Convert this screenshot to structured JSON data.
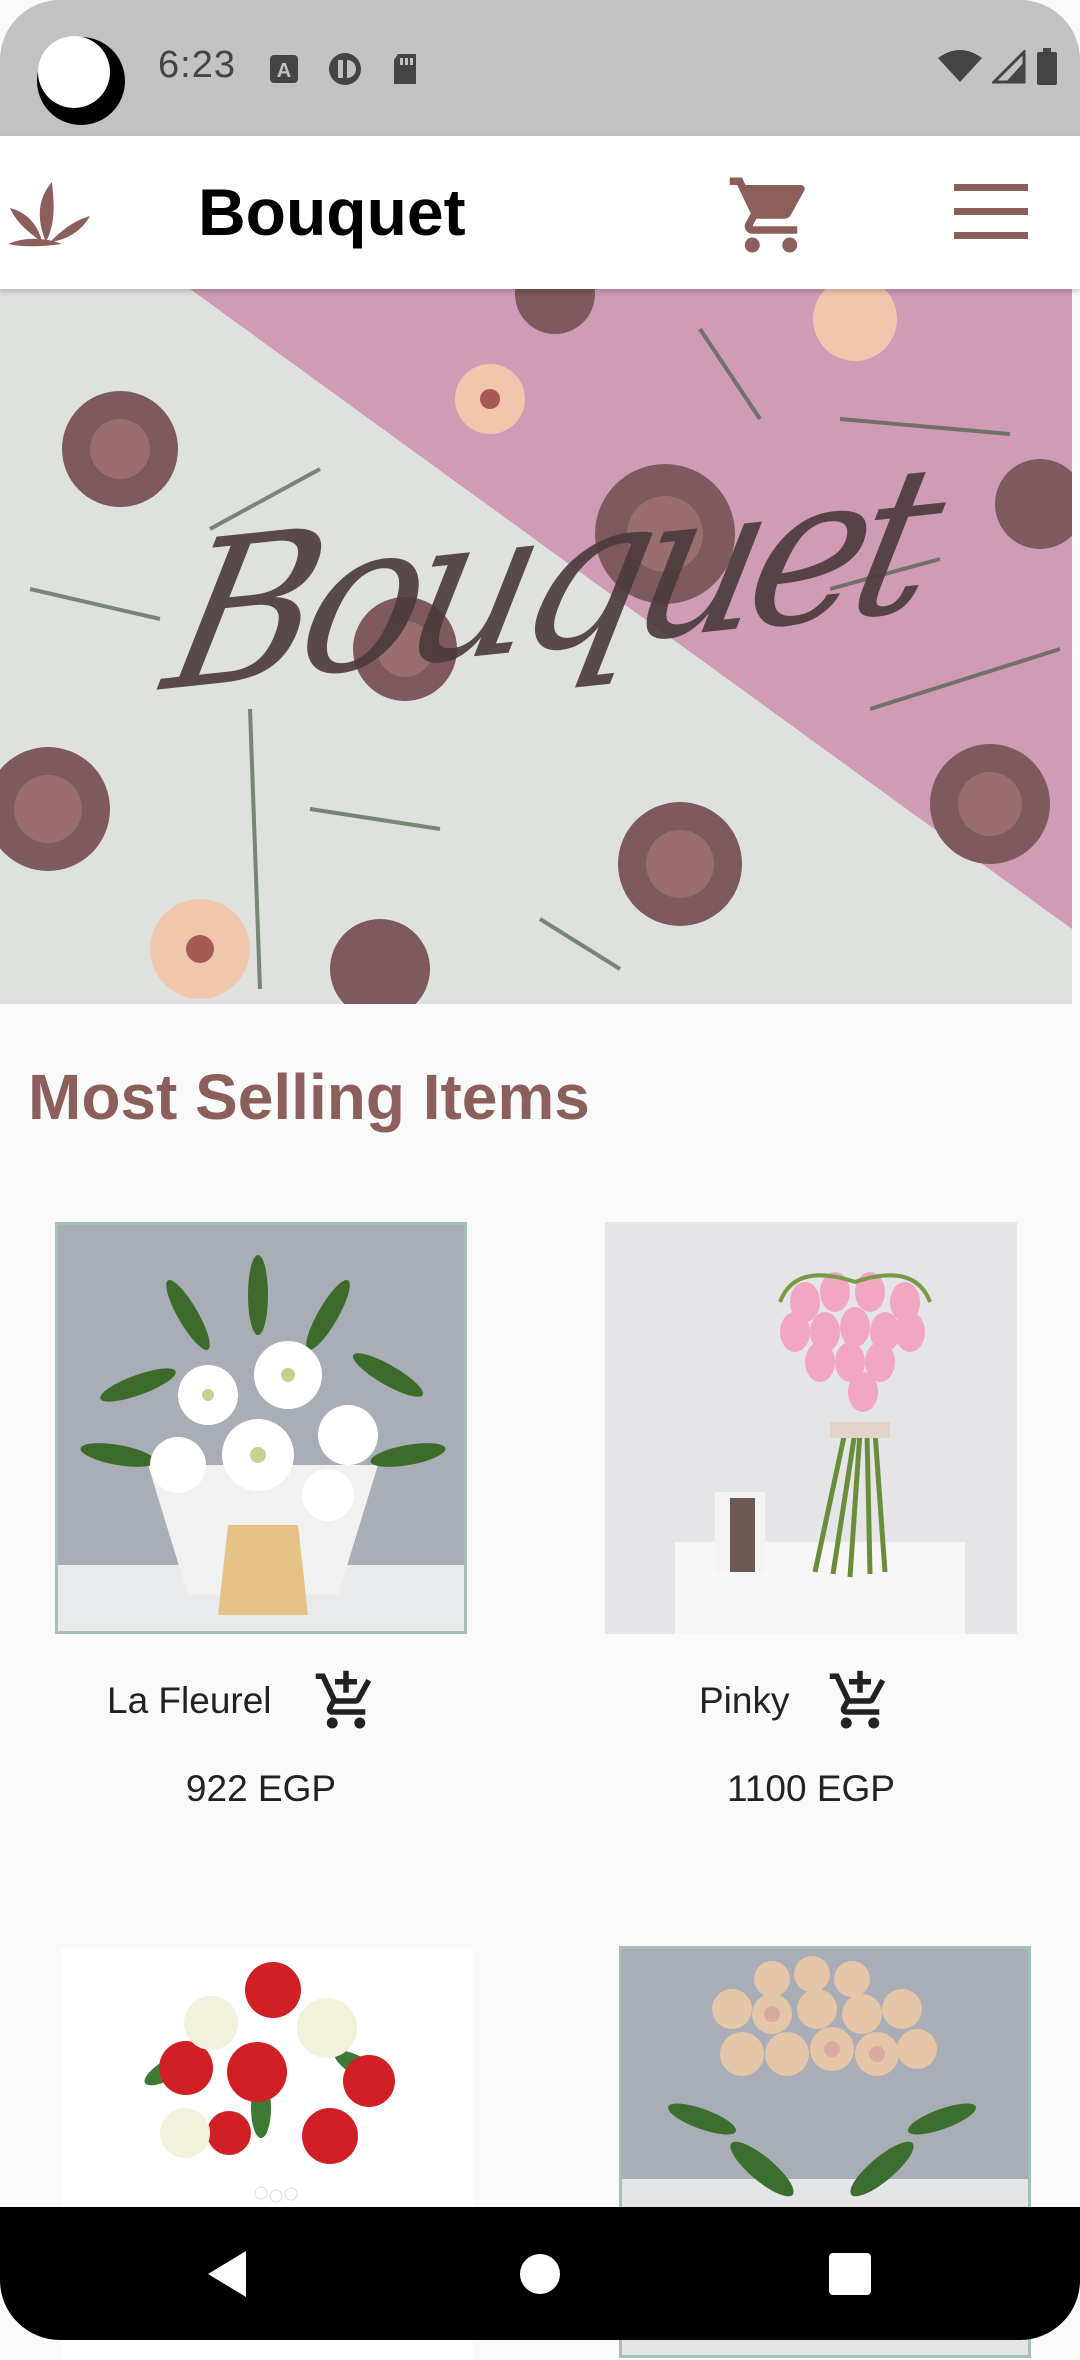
{
  "status_bar": {
    "time": "6:23",
    "notification_icons": [
      "a-notification-icon",
      "app-notification-icon",
      "sd-card-icon"
    ],
    "system_icons": [
      "wifi-icon",
      "cell-signal-icon",
      "battery-icon"
    ]
  },
  "app_bar": {
    "title": "Bouquet",
    "logo_icon": "lotus-logo-icon",
    "cart_icon": "shopping-cart-icon",
    "menu_icon": "hamburger-menu-icon"
  },
  "hero": {
    "script_text": "Bouquet"
  },
  "section": {
    "title": "Most Selling Items"
  },
  "products": [
    {
      "name": "La Fleurel",
      "price": "922 EGP",
      "cart_icon": "add-shopping-cart-icon"
    },
    {
      "name": "Pinky",
      "price": "1100 EGP",
      "cart_icon": "add-shopping-cart-icon"
    },
    {
      "name": "",
      "price": ""
    },
    {
      "name": "",
      "price": ""
    }
  ],
  "nav_bar": {
    "icons": [
      "back-icon",
      "home-icon",
      "recents-icon"
    ]
  },
  "colors": {
    "accent": "#8d5f5c",
    "status_bar": "#c2c2c2",
    "background": "#fafafa"
  }
}
